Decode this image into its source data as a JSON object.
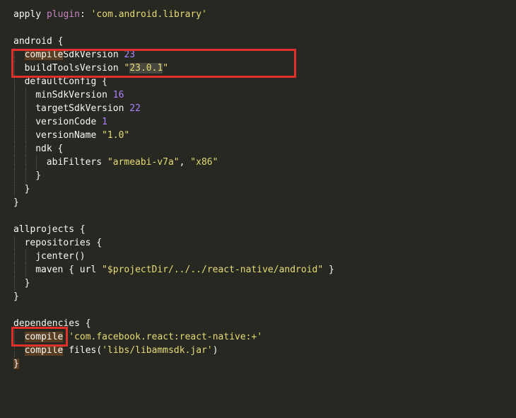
{
  "editor": {
    "theme_colors": {
      "background": "#272822",
      "text": "#f8f8f2",
      "string": "#e6db74",
      "number": "#ae81ff",
      "keyword": "#c586c0",
      "annotation_box": "#e0302a"
    },
    "lines": [
      [
        {
          "t": "apply "
        },
        {
          "t": "plugin",
          "c": "kw-plugin"
        },
        {
          "t": ": "
        },
        {
          "t": "'com.android.library'",
          "c": "str"
        }
      ],
      [],
      [
        {
          "t": "android {"
        }
      ],
      [
        {
          "t": "compile",
          "c": "hl"
        },
        {
          "t": "SdkVersion "
        },
        {
          "t": "23",
          "c": "num"
        }
      ],
      [
        {
          "t": "buildToolsVersion "
        },
        {
          "t": "\"",
          "c": "str"
        },
        {
          "t": "23.0.1",
          "c": "str hlsel"
        },
        {
          "t": "\"",
          "c": "str"
        }
      ],
      [
        {
          "t": "defaultConfig {"
        }
      ],
      [
        {
          "t": "minSdkVersion "
        },
        {
          "t": "16",
          "c": "num"
        }
      ],
      [
        {
          "t": "targetSdkVersion "
        },
        {
          "t": "22",
          "c": "num"
        }
      ],
      [
        {
          "t": "versionCode "
        },
        {
          "t": "1",
          "c": "num"
        }
      ],
      [
        {
          "t": "versionName "
        },
        {
          "t": "\"1.0\"",
          "c": "str"
        }
      ],
      [
        {
          "t": "ndk {"
        }
      ],
      [
        {
          "t": "abiFilters "
        },
        {
          "t": "\"armeabi-v7a\"",
          "c": "str"
        },
        {
          "t": ", "
        },
        {
          "t": "\"x86\"",
          "c": "str"
        }
      ],
      [
        {
          "t": "}"
        }
      ],
      [
        {
          "t": "}"
        }
      ],
      [
        {
          "t": "}"
        }
      ],
      [],
      [
        {
          "t": "allprojects {"
        }
      ],
      [
        {
          "t": "repositories {"
        }
      ],
      [
        {
          "t": "jcenter()"
        }
      ],
      [
        {
          "t": "maven { url "
        },
        {
          "t": "\"$projectDir",
          "c": "str"
        },
        {
          "t": "/../../react-native/android\"",
          "c": "str"
        },
        {
          "t": " }"
        }
      ],
      [
        {
          "t": "}"
        }
      ],
      [
        {
          "t": "}"
        }
      ],
      [],
      [
        {
          "t": "dependencies {"
        }
      ],
      [
        {
          "t": "compile",
          "c": "hl"
        },
        {
          "t": " "
        },
        {
          "t": "'com.facebook.react:react-native:+'",
          "c": "str"
        }
      ],
      [
        {
          "t": "compile",
          "c": "hl"
        },
        {
          "t": " files("
        },
        {
          "t": "'libs/libammsdk.jar'",
          "c": "str"
        },
        {
          "t": ")"
        }
      ],
      [
        {
          "t": "}",
          "c": "hl"
        }
      ]
    ]
  }
}
